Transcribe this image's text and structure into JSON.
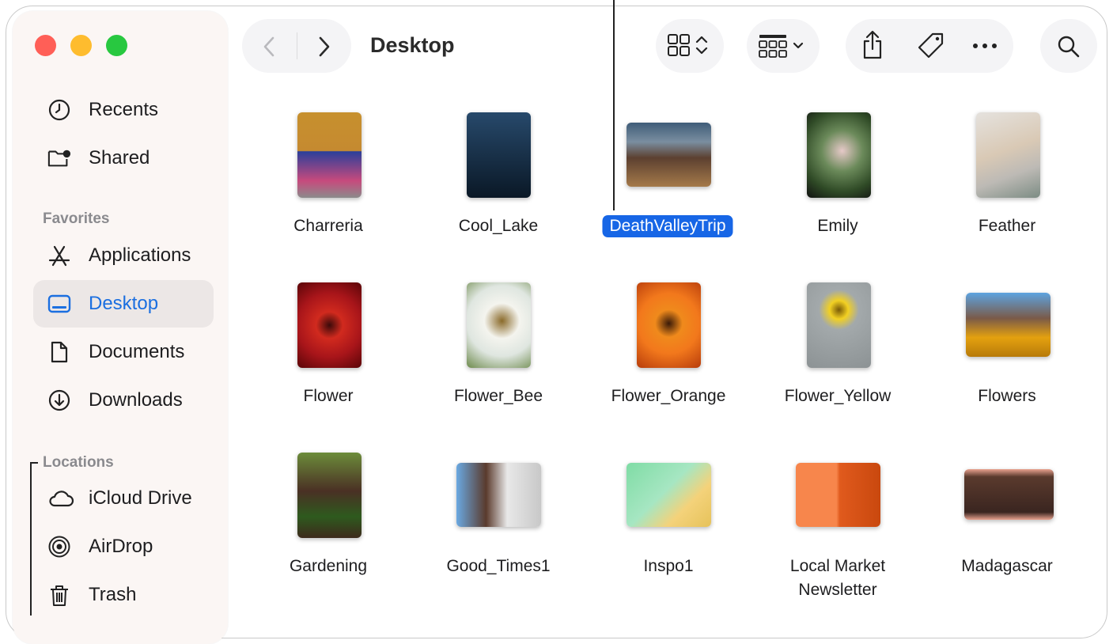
{
  "window": {
    "title": "Desktop"
  },
  "sidebar": {
    "top_items": [
      {
        "label": "Recents",
        "icon": "clock-icon"
      },
      {
        "label": "Shared",
        "icon": "shared-folder-icon"
      }
    ],
    "favorites_header": "Favorites",
    "favorites": [
      {
        "label": "Applications",
        "icon": "applications-icon"
      },
      {
        "label": "Desktop",
        "icon": "desktop-icon",
        "selected": true
      },
      {
        "label": "Documents",
        "icon": "document-icon"
      },
      {
        "label": "Downloads",
        "icon": "download-icon"
      }
    ],
    "locations_header": "Locations",
    "locations": [
      {
        "label": "iCloud Drive",
        "icon": "cloud-icon"
      },
      {
        "label": "AirDrop",
        "icon": "airdrop-icon"
      },
      {
        "label": "Trash",
        "icon": "trash-icon"
      }
    ]
  },
  "toolbar": {
    "icons": [
      "back-icon",
      "forward-icon",
      "grid-view-icon",
      "group-icon",
      "share-icon",
      "tag-icon",
      "more-icon",
      "search-icon"
    ]
  },
  "files": [
    {
      "name": "Charreria",
      "colors": [
        "#c7902e",
        "#2b3f9a"
      ]
    },
    {
      "name": "Cool_Lake",
      "colors": [
        "#1d3a55",
        "#0a1826"
      ]
    },
    {
      "name": "DeathValleyTrip",
      "selected": true,
      "colors": [
        "#3f5c78",
        "#a57a4a"
      ]
    },
    {
      "name": "Emily",
      "colors": [
        "#2f4a26",
        "#111"
      ]
    },
    {
      "name": "Feather",
      "colors": [
        "#d7d3cf",
        "#7c8c84"
      ]
    },
    {
      "name": "Flower",
      "colors": [
        "#c0151a",
        "#5a0508"
      ]
    },
    {
      "name": "Flower_Bee",
      "colors": [
        "#e9ecec",
        "#6d8a4c"
      ]
    },
    {
      "name": "Flower_Orange",
      "colors": [
        "#f2781c",
        "#b73c0b"
      ]
    },
    {
      "name": "Flower_Yellow",
      "colors": [
        "#9da3a5",
        "#e6c21a"
      ]
    },
    {
      "name": "Flowers",
      "colors": [
        "#5da3e0",
        "#e4a10f"
      ]
    },
    {
      "name": "Gardening",
      "colors": [
        "#6c8c3a",
        "#3d2a1c"
      ]
    },
    {
      "name": "Good_Times1",
      "colors": [
        "#6aa9e2",
        "#c8c8c8"
      ]
    },
    {
      "name": "Inspo1",
      "colors": [
        "#7fdca5",
        "#f4d27a"
      ]
    },
    {
      "name": "Local Market",
      "name2": "Newsletter",
      "colors": [
        "#f7864c",
        "#e05a1d"
      ]
    },
    {
      "name": "Madagascar",
      "colors": [
        "#5a3a2d",
        "#e9a28f"
      ]
    }
  ]
}
